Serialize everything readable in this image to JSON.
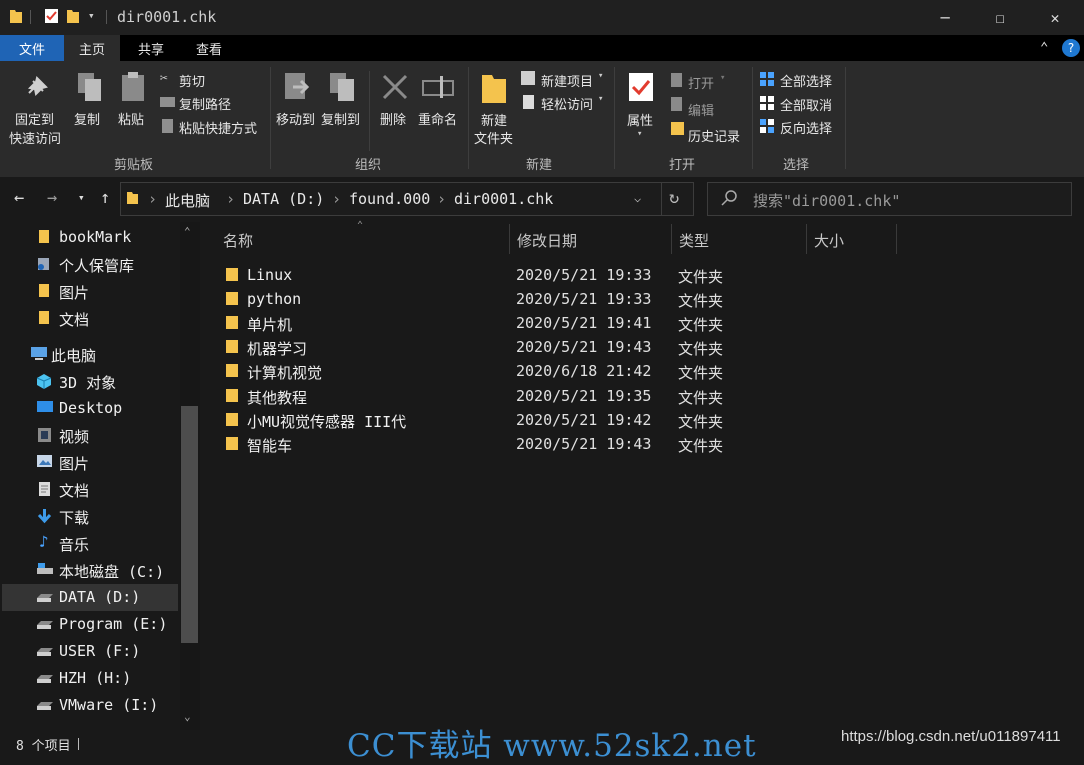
{
  "window": {
    "title": "dir0001.chk",
    "minimize_glyph": "─",
    "maximize_glyph": "☐",
    "close_glyph": "✕"
  },
  "tabs": [
    {
      "label": "文件"
    },
    {
      "label": "主页"
    },
    {
      "label": "共享"
    },
    {
      "label": "查看"
    }
  ],
  "ribbon": {
    "clipboard": {
      "pin_line1": "固定到",
      "pin_line2": "快速访问",
      "copy": "复制",
      "paste": "粘贴",
      "cut": "剪切",
      "copy_path": "复制路径",
      "paste_shortcut": "粘贴快捷方式",
      "group": "剪贴板"
    },
    "organize": {
      "move_to": "移动到",
      "copy_to": "复制到",
      "delete": "删除",
      "rename": "重命名",
      "group": "组织"
    },
    "new": {
      "new_folder_line1": "新建",
      "new_folder_line2": "文件夹",
      "new_item": "新建项目",
      "easy_access": "轻松访问",
      "group": "新建"
    },
    "open": {
      "properties": "属性",
      "open": "打开",
      "edit": "编辑",
      "history": "历史记录",
      "group": "打开"
    },
    "select": {
      "select_all": "全部选择",
      "select_none": "全部取消",
      "invert": "反向选择",
      "group": "选择"
    }
  },
  "address": {
    "crumbs": [
      "此电脑",
      "DATA (D:)",
      "found.000",
      "dir0001.chk"
    ],
    "search_placeholder": "搜索\"dir0001.chk\""
  },
  "sidebar": {
    "items": [
      {
        "label": "bookMark",
        "icon": "folder-icon"
      },
      {
        "label": "个人保管库",
        "icon": "vault-icon"
      },
      {
        "label": "图片",
        "icon": "folder-icon"
      },
      {
        "label": "文档",
        "icon": "folder-icon"
      },
      {
        "label": "此电脑",
        "icon": "computer-icon"
      },
      {
        "label": "3D 对象",
        "icon": "3d-objects-icon"
      },
      {
        "label": "Desktop",
        "icon": "desktop-icon"
      },
      {
        "label": "视频",
        "icon": "videos-icon"
      },
      {
        "label": "图片",
        "icon": "pictures-icon"
      },
      {
        "label": "文档",
        "icon": "documents-icon"
      },
      {
        "label": "下载",
        "icon": "download-icon"
      },
      {
        "label": "音乐",
        "icon": "music-icon"
      },
      {
        "label": "本地磁盘 (C:)",
        "icon": "system-drive-icon"
      },
      {
        "label": "DATA (D:)",
        "icon": "drive-icon",
        "selected": true
      },
      {
        "label": "Program (E:)",
        "icon": "drive-icon"
      },
      {
        "label": "USER (F:)",
        "icon": "drive-icon"
      },
      {
        "label": "HZH (H:)",
        "icon": "drive-icon"
      },
      {
        "label": "VMware (I:)",
        "icon": "drive-icon"
      }
    ]
  },
  "columns": {
    "name": "名称",
    "modified": "修改日期",
    "type": "类型",
    "size": "大小"
  },
  "files": [
    {
      "name": "Linux",
      "modified": "2020/5/21 19:33",
      "type": "文件夹"
    },
    {
      "name": "python",
      "modified": "2020/5/21 19:33",
      "type": "文件夹"
    },
    {
      "name": "单片机",
      "modified": "2020/5/21 19:41",
      "type": "文件夹"
    },
    {
      "name": "机器学习",
      "modified": "2020/5/21 19:43",
      "type": "文件夹"
    },
    {
      "name": "计算机视觉",
      "modified": "2020/6/18 21:42",
      "type": "文件夹"
    },
    {
      "name": "其他教程",
      "modified": "2020/5/21 19:35",
      "type": "文件夹"
    },
    {
      "name": "小MU视觉传感器 III代",
      "modified": "2020/5/21 19:42",
      "type": "文件夹"
    },
    {
      "name": "智能车",
      "modified": "2020/5/21 19:43",
      "type": "文件夹"
    }
  ],
  "status": {
    "item_count": "8 个项目"
  },
  "watermarks": {
    "site": "CC下载站 www.52sk2.net",
    "blog": "https://blog.csdn.net/u011897411"
  },
  "colors": {
    "accent": "#1f64b5",
    "folder": "#f4c34d",
    "background": "#191919"
  }
}
